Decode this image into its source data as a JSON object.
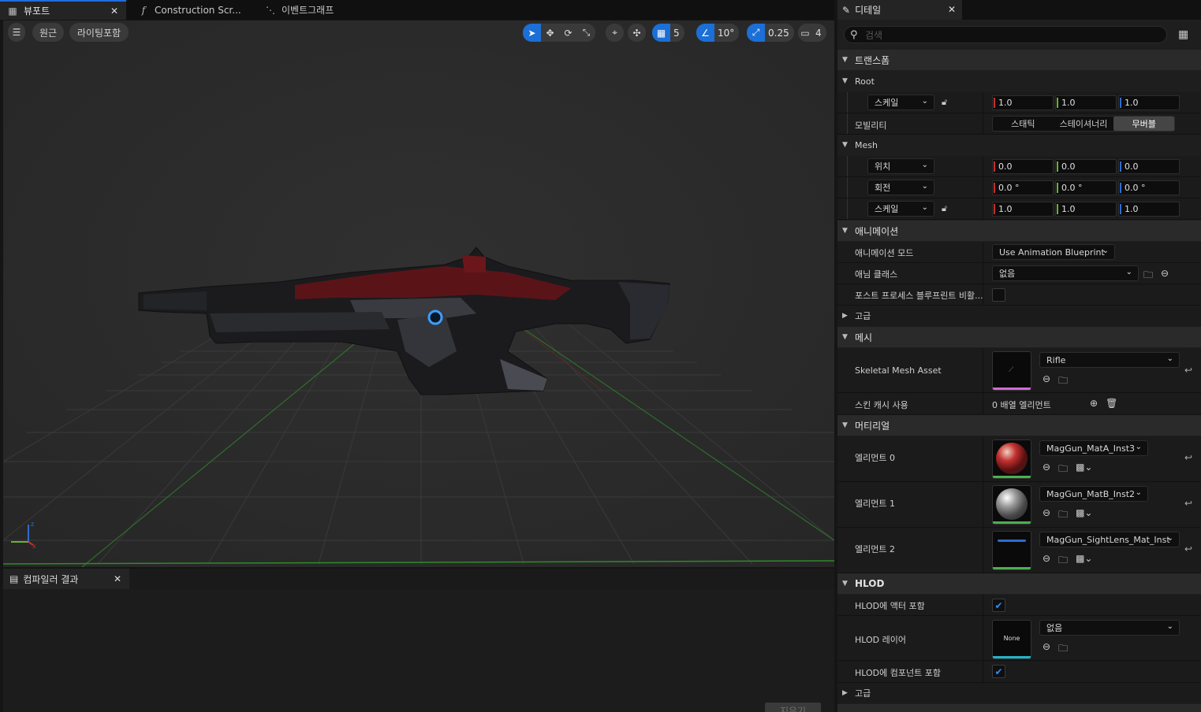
{
  "tabs": {
    "viewport": "뷰포트",
    "construction": "Construction Scr...",
    "eventgraph": "이벤트그래프"
  },
  "viewport": {
    "perspective": "원근",
    "lighting": "라이팅포함",
    "grid_snap": "5",
    "angle_snap": "10°",
    "scale_snap": "0.25",
    "camera_speed": "4"
  },
  "compiler": {
    "tab": "컴파일러 결과",
    "clear": "지우기"
  },
  "details": {
    "tab": "디테일",
    "search_placeholder": "검색",
    "transform": {
      "title": "트랜스폼",
      "root": {
        "title": "Root",
        "scale_label": "스케일",
        "scale": [
          "1.0",
          "1.0",
          "1.0"
        ],
        "mobility_label": "모빌리티",
        "mobility_options": [
          "스태틱",
          "스테이셔너리",
          "무버블"
        ],
        "mobility_selected": "무버블"
      },
      "mesh": {
        "title": "Mesh",
        "location_label": "위치",
        "location": [
          "0.0",
          "0.0",
          "0.0"
        ],
        "rotation_label": "회전",
        "rotation": [
          "0.0 °",
          "0.0 °",
          "0.0 °"
        ],
        "scale_label": "스케일",
        "scale": [
          "1.0",
          "1.0",
          "1.0"
        ]
      }
    },
    "animation": {
      "title": "애니메이션",
      "mode_label": "애니메이션 모드",
      "mode_value": "Use Animation Blueprint",
      "class_label": "애님 클래스",
      "class_value": "없음",
      "postprocess_label": "포스트 프로세스 블루프린트 비활...",
      "advanced": "고급"
    },
    "mesh_section": {
      "title": "메시",
      "asset_label": "Skeletal Mesh Asset",
      "asset_value": "Rifle",
      "skin_cache_label": "스킨 캐시 사용",
      "skin_cache_value": "0 배열 엘리먼트"
    },
    "materials": {
      "title": "머티리얼",
      "items": [
        {
          "label": "엘리먼트 0",
          "value": "MagGun_MatA_Inst3"
        },
        {
          "label": "엘리먼트 1",
          "value": "MagGun_MatB_Inst2"
        },
        {
          "label": "엘리먼트 2",
          "value": "MagGun_SightLens_Mat_Inst"
        }
      ]
    },
    "hlod": {
      "title": "HLOD",
      "include_actor_label": "HLOD에 액터 포함",
      "layer_label": "HLOD 레이어",
      "layer_thumb": "None",
      "layer_value": "없음",
      "include_component_label": "HLOD에 컴포넌트 포함",
      "advanced": "고급"
    }
  },
  "colors": {
    "accent": "#1b6fd6",
    "axis_x": "#c8302c",
    "axis_y": "#6db033",
    "axis_z": "#2e6ccf"
  }
}
